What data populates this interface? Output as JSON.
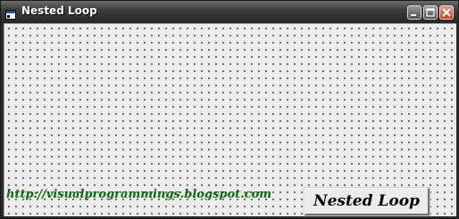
{
  "window": {
    "title": "Nested Loop",
    "controls": [
      "minimize-icon",
      "maximize-icon",
      "close-icon"
    ]
  },
  "form": {
    "url_label": "http://visualprogrammings.blogspot.com",
    "button_label": "Nested Loop"
  },
  "colors": {
    "url_text": "#0b6b0b",
    "form_background": "#ececec",
    "close_button": "#d9532c"
  }
}
